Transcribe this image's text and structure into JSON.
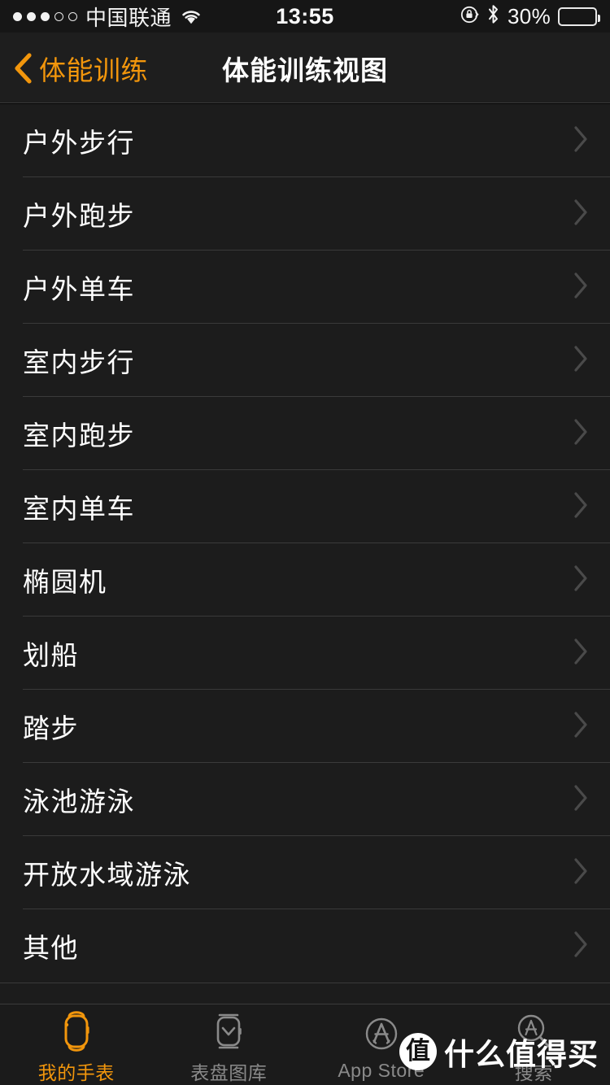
{
  "status_bar": {
    "signal_filled": 3,
    "signal_total": 5,
    "carrier": "中国联通",
    "wifi_icon": "wifi-icon",
    "time": "13:55",
    "rotation_lock_icon": "rotation-lock-icon",
    "bluetooth_icon": "bluetooth-icon",
    "battery_percent_label": "30%",
    "battery_level": 30
  },
  "nav_bar": {
    "back_icon": "chevron-left-icon",
    "back_label": "体能训练",
    "title": "体能训练视图"
  },
  "list": {
    "disclosure_icon": "chevron-right-icon",
    "rows": [
      {
        "label": "户外步行"
      },
      {
        "label": "户外跑步"
      },
      {
        "label": "户外单车"
      },
      {
        "label": "室内步行"
      },
      {
        "label": "室内跑步"
      },
      {
        "label": "室内单车"
      },
      {
        "label": "椭圆机"
      },
      {
        "label": "划船"
      },
      {
        "label": "踏步"
      },
      {
        "label": "泳池游泳"
      },
      {
        "label": "开放水域游泳"
      },
      {
        "label": "其他"
      }
    ]
  },
  "tab_bar": {
    "tabs": [
      {
        "label": "我的手表",
        "icon": "watch-icon",
        "active": true
      },
      {
        "label": "表盘图库",
        "icon": "watch-face-icon",
        "active": false
      },
      {
        "label": "App Store",
        "icon": "app-store-icon",
        "active": false
      },
      {
        "label": "搜索",
        "icon": "app-store-search-icon",
        "active": false
      }
    ]
  },
  "watermark": {
    "logo_text": "值",
    "text": "什么值得买"
  },
  "colors": {
    "accent": "#f2960c",
    "background": "#1c1c1c",
    "nav_background": "#1e1e1e",
    "status_background": "#161616",
    "tab_background": "#1b1b1b",
    "separator": "#3a3a3a",
    "text_primary": "#ffffff",
    "text_secondary": "#8a8a8a",
    "chevron": "#4a4a4a"
  }
}
